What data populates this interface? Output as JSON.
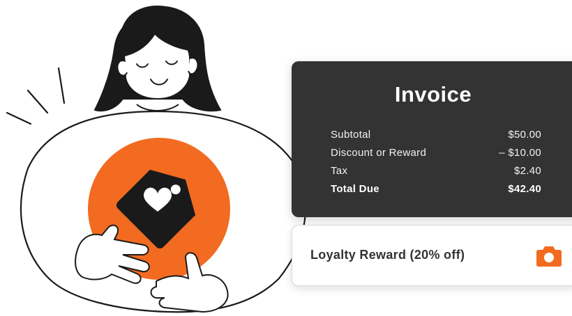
{
  "invoice": {
    "title": "Invoice",
    "rows": [
      {
        "label": "Subtotal",
        "value": "$50.00"
      },
      {
        "label": "Discount or Reward",
        "value": "– $10.00"
      },
      {
        "label": "Tax",
        "value": "$2.40"
      }
    ],
    "total": {
      "label": "Total Due",
      "value": "$42.40"
    }
  },
  "reward": {
    "label": "Loyalty Reward (20% off)",
    "icon": "camera-icon"
  },
  "illustration": {
    "icon": "price-tag-heart-icon"
  },
  "colors": {
    "accent": "#F26B21",
    "card_dark": "#333333",
    "ink": "#1a1a1a"
  }
}
